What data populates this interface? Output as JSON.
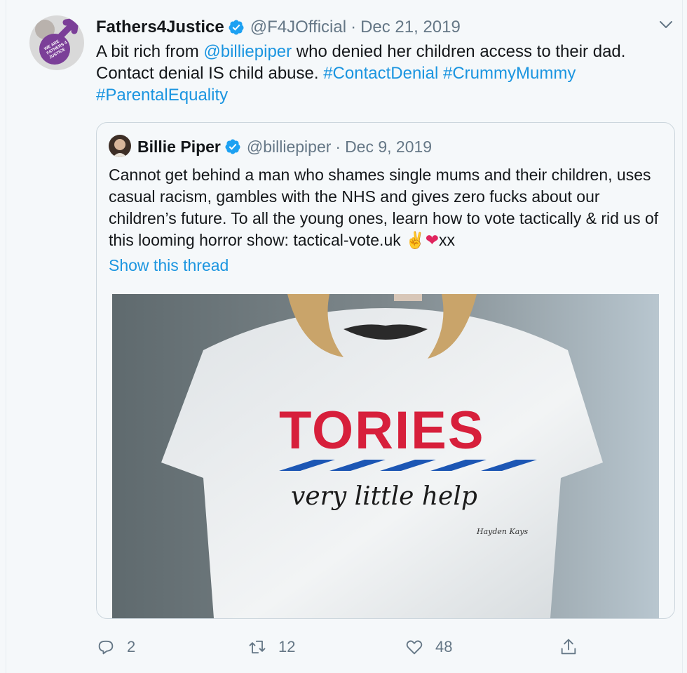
{
  "tweet": {
    "author_name": "Fathers4Justice",
    "author_handle": "@F4JOfficial",
    "separator": "·",
    "date": "Dec 21, 2019",
    "avatar_text": "WE ARE FATHERS 4 JUSTICE",
    "text_part1": "A bit rich from ",
    "mention": "@billiepiper",
    "text_part2": " who denied her children access to their dad. Contact denial IS child abuse. ",
    "hashtag1": "#ContactDenial",
    "hashtag2": "#CrummyMummy",
    "hashtag3": "#ParentalEquality"
  },
  "quote": {
    "author_name": "Billie Piper",
    "author_handle": "@billiepiper",
    "separator": "·",
    "date": "Dec 9, 2019",
    "text": "Cannot get behind a man who shames single mums and their children, uses casual racism, gambles with the NHS and gives zero fucks about our children’s future. To all the young ones, learn how to vote tactically & rid us of this looming horror show: tactical-vote.uk ",
    "emoji_victory": "✌",
    "emoji_heart": "❤",
    "text_tail": "xx",
    "show_thread": "Show this thread",
    "image": {
      "shirt_word": "TORIES",
      "shirt_tagline": "very little help",
      "shirt_signature": "Hayden Kays"
    }
  },
  "actions": {
    "reply_count": "2",
    "retweet_count": "12",
    "like_count": "48"
  },
  "colors": {
    "link": "#1b95e0",
    "verified": "#1da1f2",
    "secondary_text": "#657786",
    "tories_red": "#d71f3b",
    "tories_blue": "#1c56b4"
  },
  "icons": [
    "verified-badge-icon",
    "chevron-down-icon",
    "reply-icon",
    "retweet-icon",
    "like-icon",
    "share-icon"
  ]
}
